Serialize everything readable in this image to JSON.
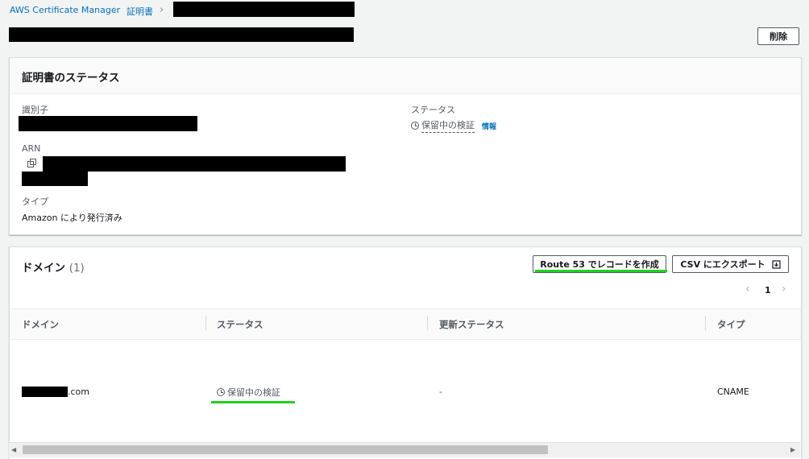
{
  "breadcrumb": {
    "service": "AWS Certificate Manager",
    "section": "証明書"
  },
  "header": {
    "delete_label": "削除"
  },
  "status_panel": {
    "title": "証明書のステータス",
    "identifier_label": "識別子",
    "arn_label": "ARN",
    "type_label": "タイプ",
    "type_value": "Amazon により発行済み",
    "status_label": "ステータス",
    "status_value": "保留中の検証",
    "info_link": "情報"
  },
  "domain_panel": {
    "title": "ドメイン",
    "count": "(1)",
    "route53_button": "Route 53 でレコードを作成",
    "csv_button": "CSV にエクスポート",
    "pagination": {
      "page": "1"
    },
    "columns": [
      "ドメイン",
      "ステータス",
      "更新ステータス",
      "タイプ"
    ],
    "rows": [
      {
        "domain_suffix": ".com",
        "status": "保留中の検証",
        "renewal_status": "-",
        "type": "CNAME"
      }
    ]
  },
  "colors": {
    "link": "#0073bb",
    "highlight": "#1dd31d",
    "text_secondary": "#545b64"
  }
}
